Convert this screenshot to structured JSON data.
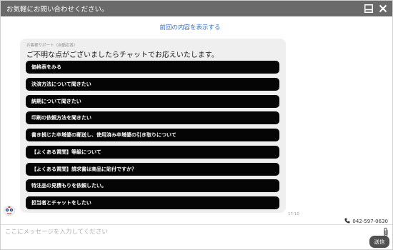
{
  "header": {
    "title": "お気軽にお問い合わせください。",
    "minimize_icon": "minimize-icon",
    "close_icon": "close-icon"
  },
  "history_link": "前回の内容を表示する",
  "message": {
    "sender": "お客様サポート（自動応答）",
    "text": "ご不明な点がございましたらチャットでお応えいたします。",
    "time": "17:10",
    "options": [
      "価格表をみる",
      "決済方法について聞きたい",
      "納期について聞きたい",
      "印刷の依頼方法を聞きたい",
      "書き損じた卒塔婆の郵送し、使用済み卒塔婆の引き取りについて",
      "【よくある質問】等級について",
      "【よくある質問】請求書は商品に貼付ですか？",
      "特注品の見積もりを依頼したい。",
      "担当者とチャットをしたい"
    ]
  },
  "contact": {
    "phone": "042-597-0630",
    "phone_icon": "phone-icon"
  },
  "composer": {
    "placeholder": "ここにメッセージを入力してください",
    "send_label": "送信",
    "attach_icon": "paperclip-icon"
  },
  "colors": {
    "header_bg": "#6a6a6a",
    "link": "#3173c7",
    "bubble_bg": "#efefef",
    "option_bg": "#050505",
    "send_bg": "#505050"
  }
}
